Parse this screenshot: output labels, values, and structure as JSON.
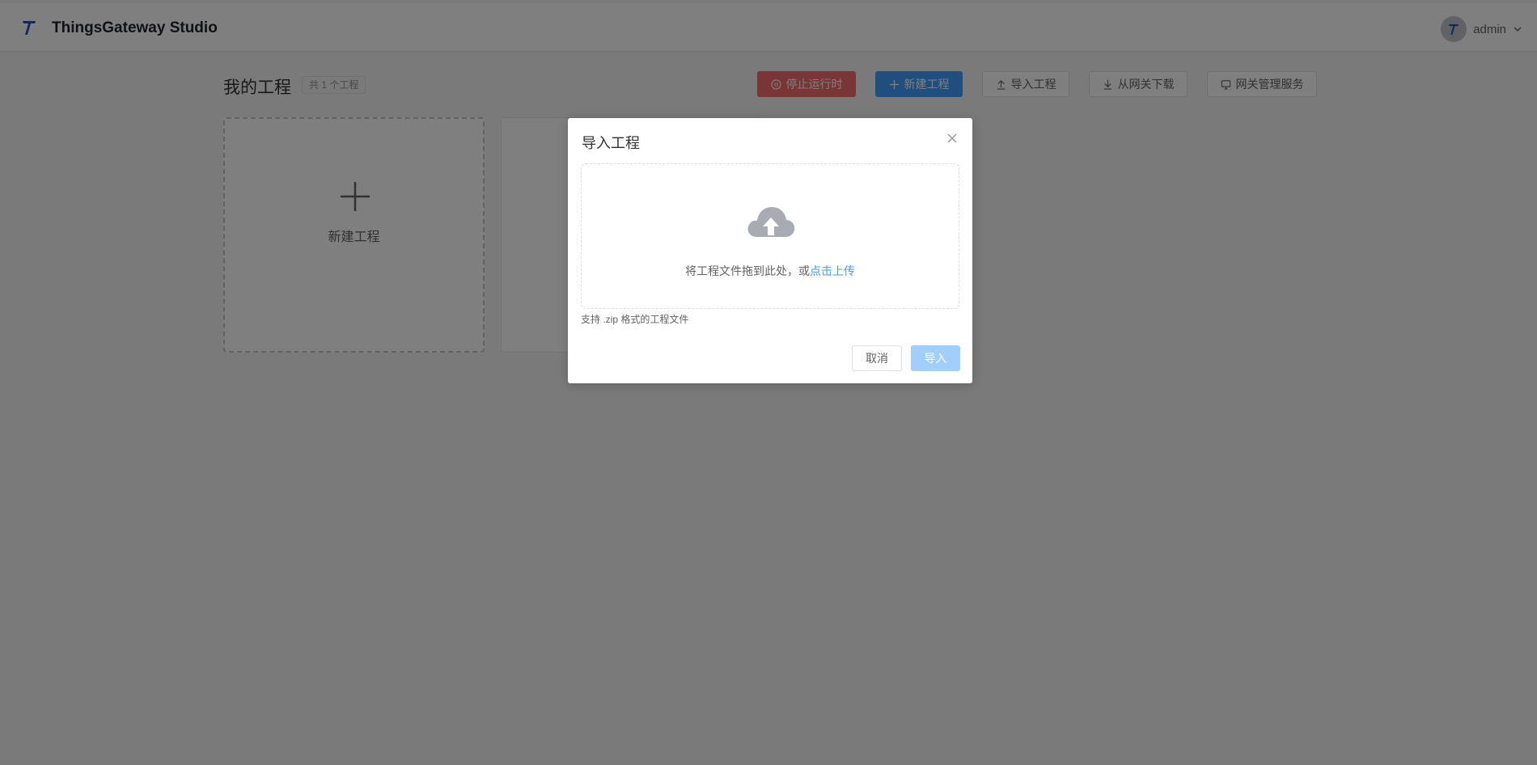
{
  "header": {
    "app_title": "ThingsGateway Studio",
    "user_name": "admin"
  },
  "toolbar": {
    "page_title": "我的工程",
    "project_count": "共 1 个工程",
    "stop_runtime": "停止运行时",
    "new_project": "新建工程",
    "import_project": "导入工程",
    "download_from_gateway": "从网关下载",
    "gateway_service": "网关管理服务"
  },
  "cards": {
    "new_project_label": "新建工程"
  },
  "dialog": {
    "title": "导入工程",
    "drop_text": "将工程文件拖到此处，或",
    "upload_link": "点击上传",
    "hint": "支持 .zip 格式的工程文件",
    "cancel": "取消",
    "confirm": "导入"
  },
  "colors": {
    "primary": "#409eff",
    "danger": "#f56c6c",
    "primary_disabled": "#a0cfff"
  },
  "icons": [
    "logo-icon",
    "user-avatar-icon",
    "chevron-down-icon",
    "pause-icon",
    "plus-icon",
    "upload-icon",
    "download-icon",
    "monitor-icon",
    "close-icon",
    "cloud-upload-icon"
  ]
}
